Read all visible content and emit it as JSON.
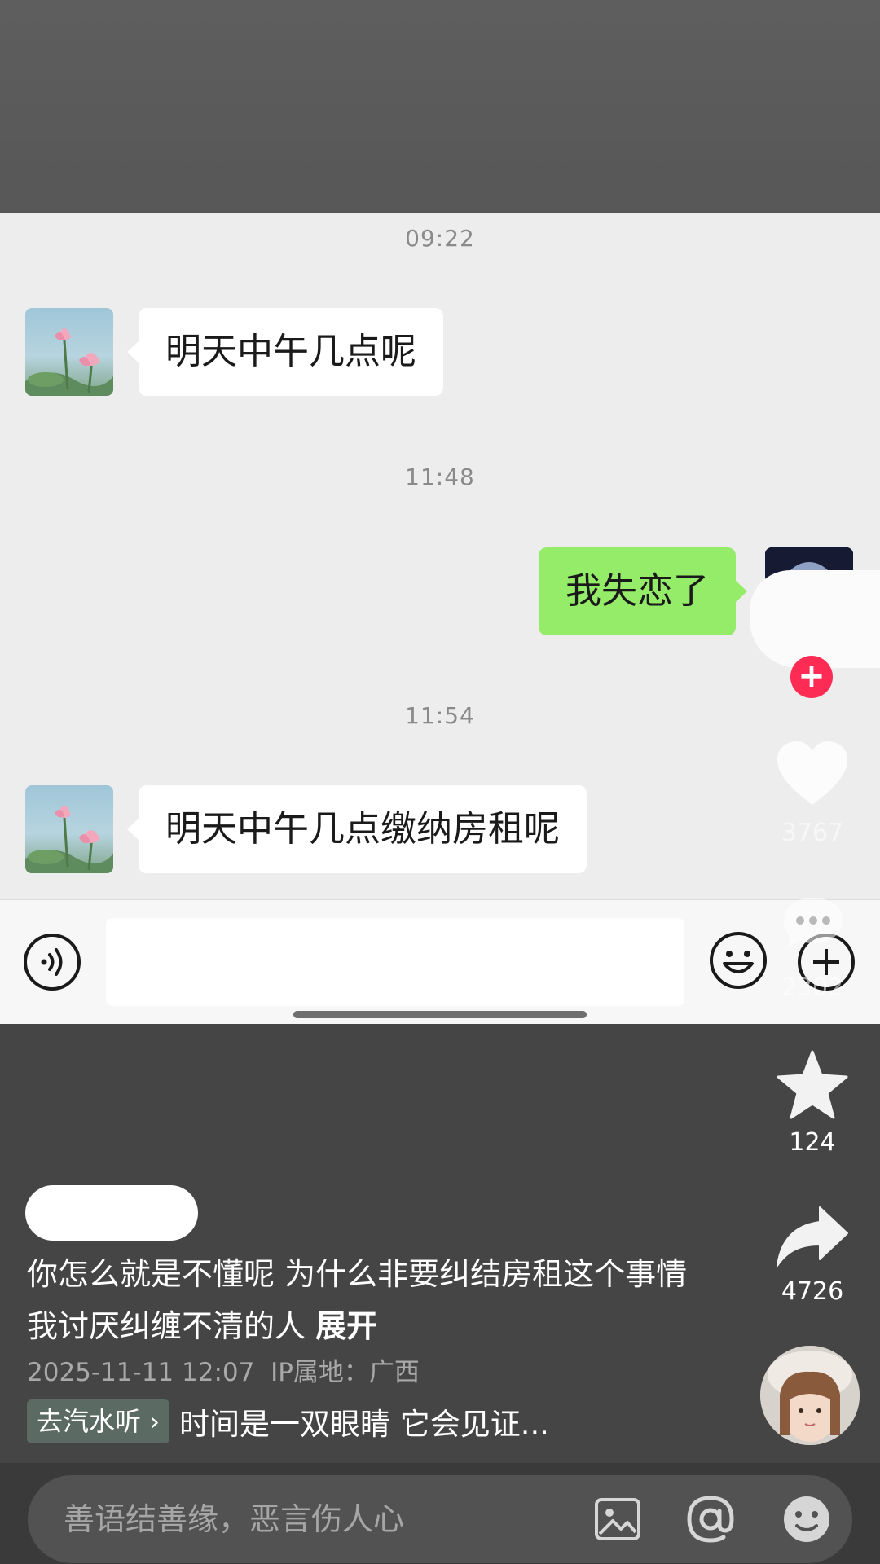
{
  "chat": {
    "timestamps": [
      "09:22",
      "11:48",
      "11:54"
    ],
    "messages": [
      {
        "from": "other",
        "text": "明天中午几点呢"
      },
      {
        "from": "me",
        "text": "我失恋了"
      },
      {
        "from": "other",
        "text": "明天中午几点缴纳房租呢"
      }
    ]
  },
  "overlay": {
    "like_count": "3767",
    "comment_count": "2302",
    "favorite_count": "124",
    "share_count": "4726"
  },
  "post": {
    "caption": "你怎么就是不懂呢 为什么非要纠结房租这个事情 我讨厌纠缠不清的人",
    "expand_label": "展开",
    "datetime": "2025-11-11 12:07",
    "ip_location": "IP属地：广西",
    "music_tag": "去汽水听",
    "music_title": "时间是一双眼睛 它会见证..."
  },
  "comment_input": {
    "placeholder": "善语结善缘，恶言伤人心"
  },
  "colors": {
    "sent_bubble": "#95ec69",
    "received_bubble": "#ffffff",
    "follow_plus": "#fe2c55"
  }
}
